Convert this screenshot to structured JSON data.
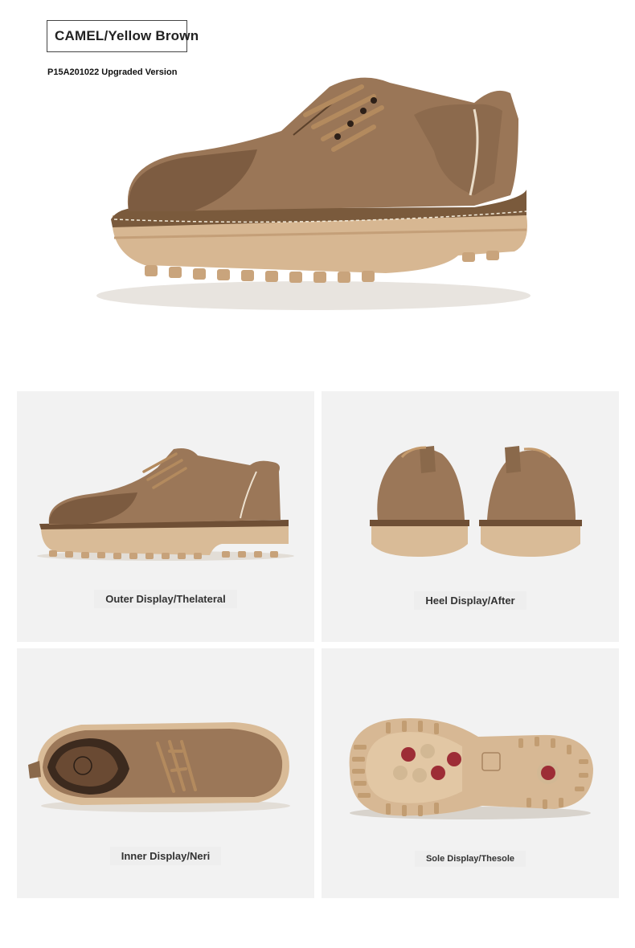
{
  "header": {
    "title": "CAMEL/Yellow Brown",
    "subtitle": "P15A201022 Upgraded Version"
  },
  "panels": [
    {
      "caption": "Outer Display/Thelateral"
    },
    {
      "caption": "Heel Display/After"
    },
    {
      "caption": "Inner Display/Neri"
    },
    {
      "caption": "Sole Display/Thesole"
    }
  ]
}
